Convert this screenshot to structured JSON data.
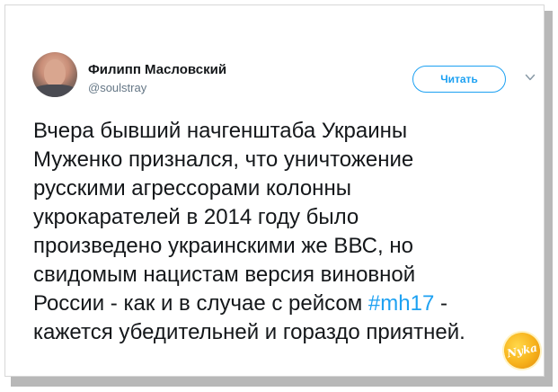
{
  "author": {
    "name": "Филипп Масловский",
    "handle": "@soulstray"
  },
  "follow_button": {
    "label": "Читать"
  },
  "menu": {
    "icon": "chevron-down-icon"
  },
  "tweet": {
    "lines": [
      "Вчера бывший начгенштаба Украины",
      "Муженко признался, что уничтожение",
      "русскими агрессорами колонны",
      "укрокарателей в 2014 году было",
      "произведено украинскими же ВВС, но",
      "свидомым нацистам версия виновной",
      "России - как и в случае с рейсом ",
      "кажется убедительней и гораздо приятней."
    ],
    "hashtag": "#mh17",
    "after_hashtag": " -"
  },
  "watermark": {
    "text": "Nyka"
  },
  "colors": {
    "accent": "#1da1f2",
    "text": "#14171a",
    "muted": "#657786"
  }
}
